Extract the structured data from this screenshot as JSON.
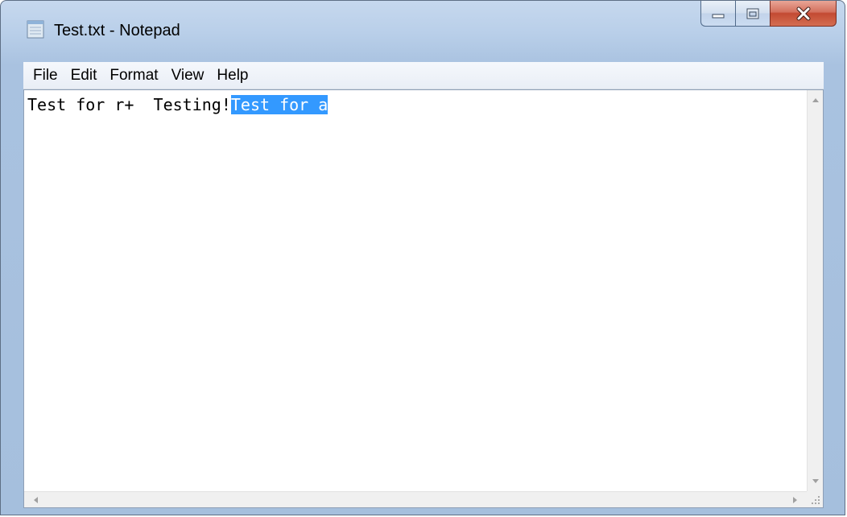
{
  "window": {
    "title": "Test.txt - Notepad",
    "icon": "notepad-icon"
  },
  "caption": {
    "minimize_icon": "minimize-icon",
    "maximize_icon": "maximize-icon",
    "close_icon": "close-icon"
  },
  "menu": {
    "items": [
      {
        "label": "File"
      },
      {
        "label": "Edit"
      },
      {
        "label": "Format"
      },
      {
        "label": "View"
      },
      {
        "label": "Help"
      }
    ]
  },
  "editor": {
    "text_before_selection": "Test for r+  Testing!",
    "selected_text": "Test for a"
  },
  "colors": {
    "selection": "#3399ff",
    "close_button": "#c34a32"
  }
}
